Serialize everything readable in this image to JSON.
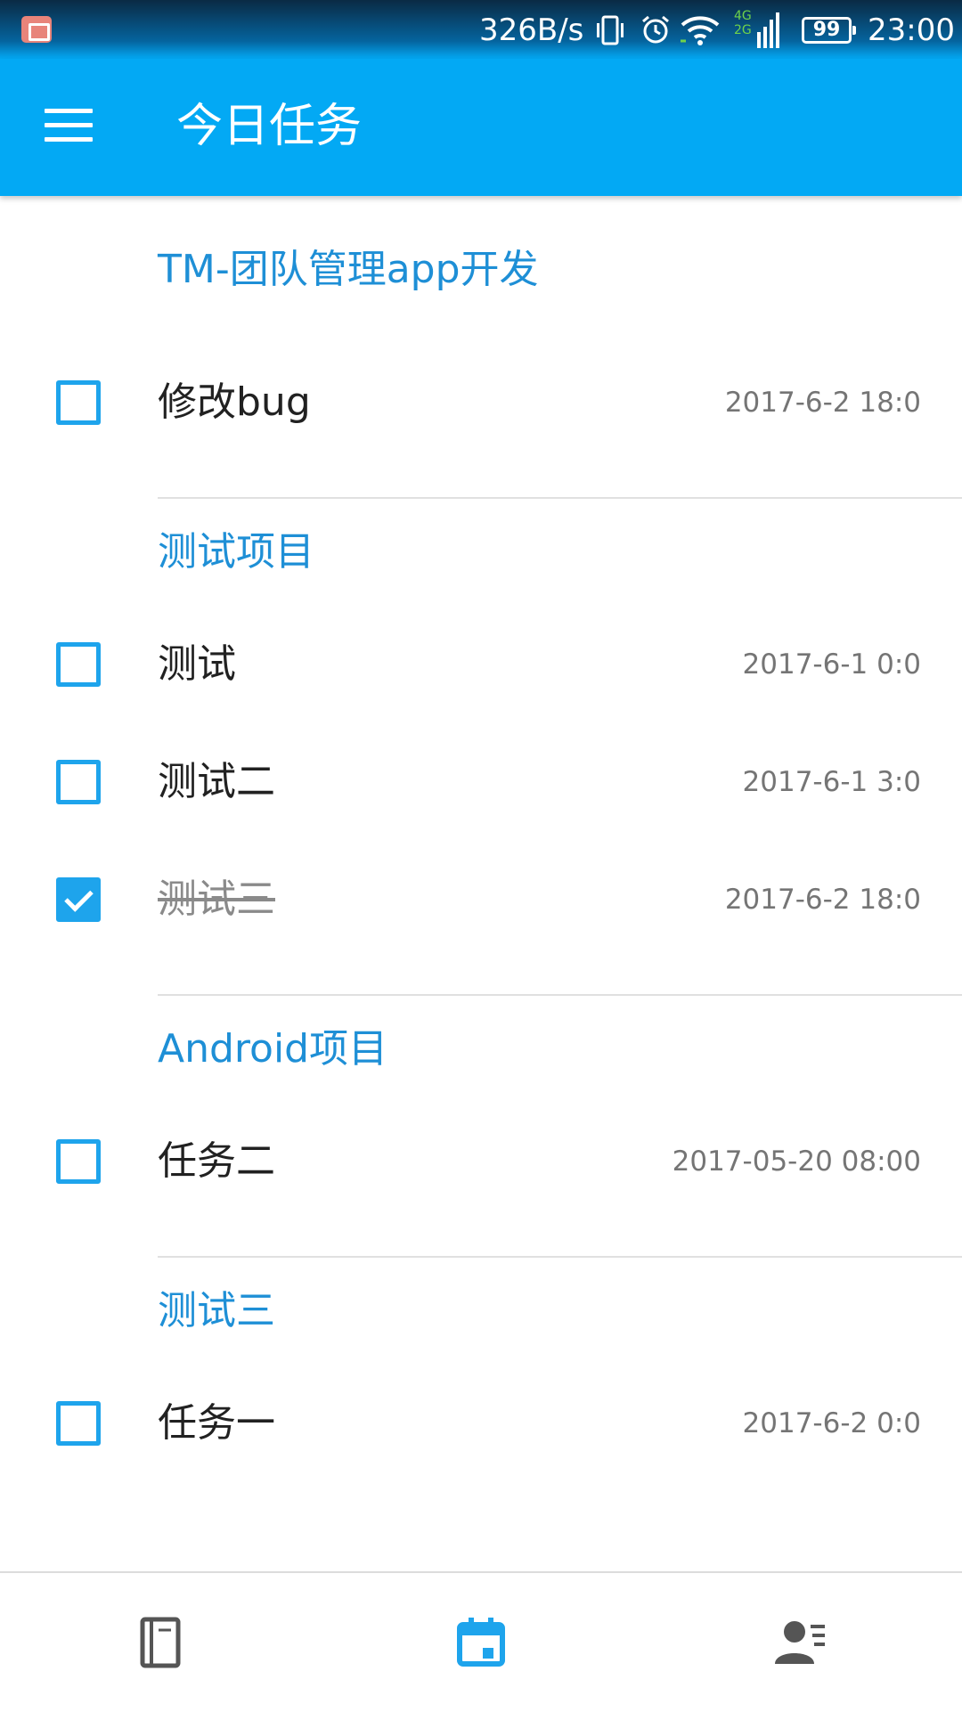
{
  "status_bar": {
    "net_speed": "326B/s",
    "battery": "99",
    "time": "23:00",
    "net_type_top": "4G",
    "net_type_bottom": "2G"
  },
  "app_bar": {
    "title": "今日任务"
  },
  "groups": [
    {
      "name": "TM-团队管理app开发",
      "tasks": [
        {
          "name": "修改bug",
          "time": "2017-6-2 18:0",
          "done": false
        }
      ]
    },
    {
      "name": "测试项目",
      "tasks": [
        {
          "name": "测试",
          "time": "2017-6-1 0:0",
          "done": false
        },
        {
          "name": "测试二",
          "time": "2017-6-1 3:0",
          "done": false
        },
        {
          "name": "测试三",
          "time": "2017-6-2 18:0",
          "done": true
        }
      ]
    },
    {
      "name": "Android项目",
      "tasks": [
        {
          "name": "任务二",
          "time": "2017-05-20 08:00",
          "done": false
        }
      ]
    },
    {
      "name": "测试三",
      "tasks": [
        {
          "name": "任务一",
          "time": "2017-6-2 0:0",
          "done": false
        }
      ]
    }
  ],
  "bottom_nav": [
    {
      "icon": "notebook-icon",
      "active": false
    },
    {
      "icon": "calendar-icon",
      "active": true
    },
    {
      "icon": "contacts-icon",
      "active": false
    }
  ],
  "colors": {
    "primary": "#03a9f4",
    "group_header": "#1e8fd6",
    "checkbox": "#1ea4ec",
    "nav_inactive": "#555555"
  }
}
